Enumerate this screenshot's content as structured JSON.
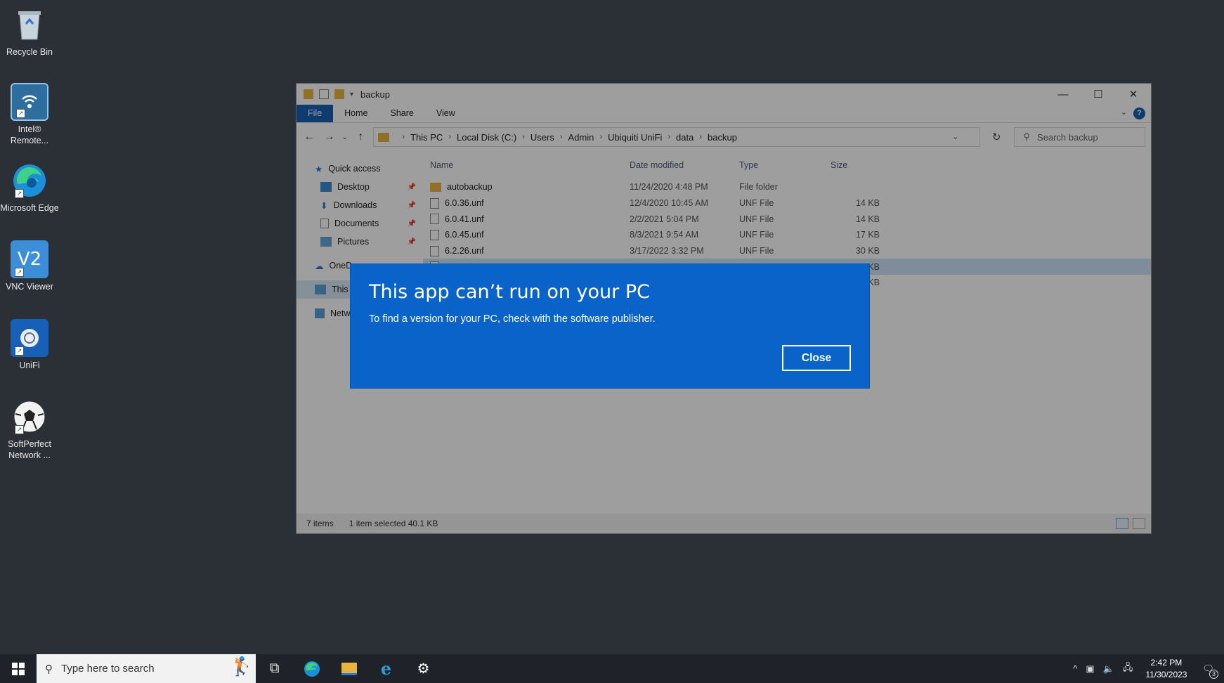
{
  "desktop": {
    "icons": [
      {
        "label": "Recycle Bin"
      },
      {
        "label": "Intel® Remote..."
      },
      {
        "label": "Microsoft Edge"
      },
      {
        "label": "VNC Viewer"
      },
      {
        "label": "UniFi"
      },
      {
        "label": "SoftPerfect Network ..."
      }
    ]
  },
  "explorer": {
    "title": "backup",
    "ribbon_tabs": [
      "File",
      "Home",
      "Share",
      "View"
    ],
    "breadcrumb": [
      "This PC",
      "Local Disk (C:)",
      "Users",
      "Admin",
      "Ubiquiti UniFi",
      "data",
      "backup"
    ],
    "search_placeholder": "Search backup",
    "nav": {
      "quick_access": "Quick access",
      "desktop": "Desktop",
      "downloads": "Downloads",
      "documents": "Documents",
      "pictures": "Pictures",
      "onedrive": "OneD",
      "this_pc": "This P",
      "network": "Netw"
    },
    "columns": {
      "name": "Name",
      "date": "Date modified",
      "type": "Type",
      "size": "Size"
    },
    "files": [
      {
        "name": "autobackup",
        "date": "11/24/2020 4:48 PM",
        "type": "File folder",
        "size": ""
      },
      {
        "name": "6.0.36.unf",
        "date": "12/4/2020 10:45 AM",
        "type": "UNF File",
        "size": "14 KB"
      },
      {
        "name": "6.0.41.unf",
        "date": "2/2/2021 5:04 PM",
        "type": "UNF File",
        "size": "14 KB"
      },
      {
        "name": "6.0.45.unf",
        "date": "8/3/2021 9:54 AM",
        "type": "UNF File",
        "size": "17 KB"
      },
      {
        "name": "6.2.26.unf",
        "date": "3/17/2022 3:32 PM",
        "type": "UNF File",
        "size": "30 KB"
      },
      {
        "name": "",
        "date": "",
        "type": "",
        "size": "KB"
      },
      {
        "name": "",
        "date": "",
        "type": "",
        "size": "KB"
      }
    ],
    "status": {
      "count": "7 items",
      "selection": "1 item selected  40.1 KB"
    }
  },
  "dialog": {
    "title": "This app can’t run on your PC",
    "message": "To find a version for your PC, check with the software publisher.",
    "close_label": "Close"
  },
  "taskbar": {
    "search_placeholder": "Type here to search",
    "time": "2:42 PM",
    "date": "11/30/2023",
    "notification_count": "3"
  },
  "colors": {
    "dialog_bg": "#0a63c9",
    "accent": "#1a5fb4",
    "taskbar_bg": "#1f2329",
    "desktop_bg": "#2b2f36"
  }
}
